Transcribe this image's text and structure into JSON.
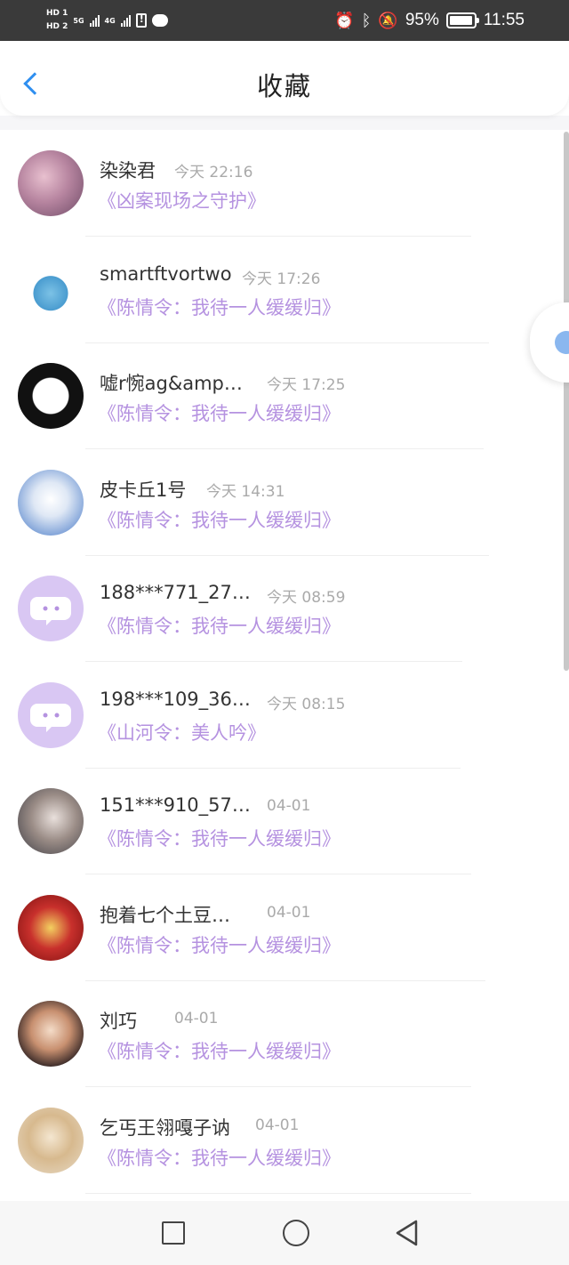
{
  "status_bar": {
    "hd1": "HD 1",
    "hd2": "HD 2",
    "net1": "5G",
    "net2": "4G",
    "battery_percent": "95%",
    "battery_level": 0.95,
    "time": "11:55",
    "icons": [
      "alarm-icon",
      "bluetooth-icon",
      "mute-icon"
    ]
  },
  "header": {
    "title": "收藏",
    "accent_color": "#2f8ff0"
  },
  "colors": {
    "work_title": "#b592e0",
    "name": "#333333",
    "time": "#aaaaaa"
  },
  "favorites": [
    {
      "name": "染染君",
      "time": "今天 22:16",
      "work": "《凶案现场之守护》"
    },
    {
      "name": "smartftvortwo",
      "time": "今天 17:26",
      "work": "《陈情令：我待一人缓缓归》"
    },
    {
      "name": "嘘r惋ag&amp…",
      "time": "今天 17:25",
      "work": "《陈情令：我待一人缓缓归》"
    },
    {
      "name": "皮卡丘1号",
      "time": "今天 14:31",
      "work": "《陈情令：我待一人缓缓归》"
    },
    {
      "name": "188***771_27…",
      "time": "今天 08:59",
      "work": "《陈情令：我待一人缓缓归》"
    },
    {
      "name": "198***109_36…",
      "time": "今天 08:15",
      "work": "《山河令：美人吟》"
    },
    {
      "name": "151***910_57…",
      "time": "04-01",
      "work": "《陈情令：我待一人缓缓归》"
    },
    {
      "name": "抱着七个土豆…",
      "time": "04-01",
      "work": "《陈情令：我待一人缓缓归》"
    },
    {
      "name": "刘巧",
      "time": "04-01",
      "work": "《陈情令：我待一人缓缓归》"
    },
    {
      "name": "乞丐王翎嘎子讷",
      "time": "04-01",
      "work": "《陈情令：我待一人缓缓归》"
    }
  ],
  "nav": {
    "icons": [
      "recent-apps-icon",
      "home-icon",
      "back-nav-icon"
    ]
  }
}
